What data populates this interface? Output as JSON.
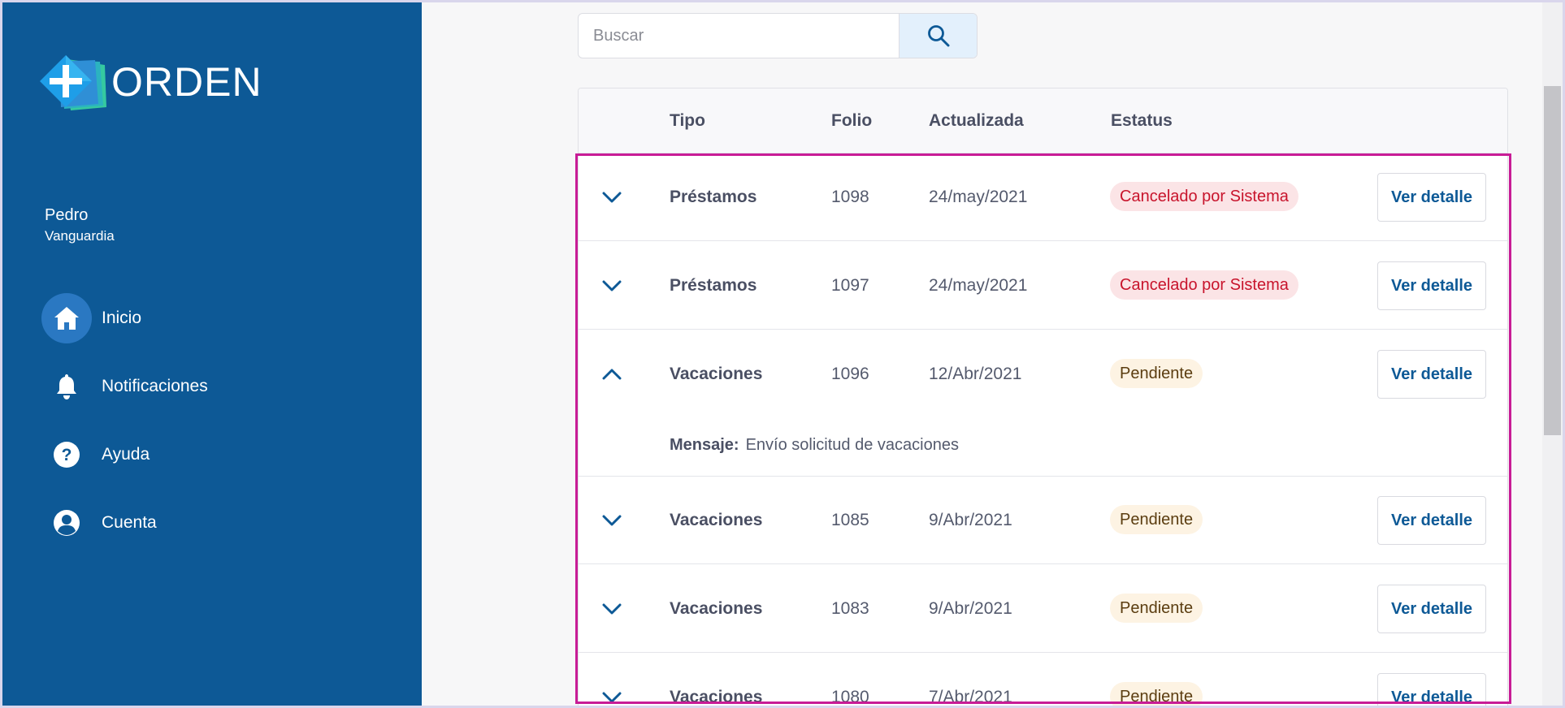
{
  "brand": {
    "name": "ORDEN"
  },
  "user": {
    "first_name": "Pedro",
    "last_name": "Vanguardia"
  },
  "nav": [
    {
      "label": "Inicio",
      "icon": "home-icon",
      "active": true
    },
    {
      "label": "Notificaciones",
      "icon": "bell-icon",
      "active": false
    },
    {
      "label": "Ayuda",
      "icon": "help-icon",
      "active": false
    },
    {
      "label": "Cuenta",
      "icon": "account-icon",
      "active": false
    }
  ],
  "search": {
    "placeholder": "Buscar",
    "value": ""
  },
  "table": {
    "headers": {
      "tipo": "Tipo",
      "folio": "Folio",
      "actualizada": "Actualizada",
      "estatus": "Estatus"
    },
    "rows": [
      {
        "tipo": "Préstamos",
        "folio": "1098",
        "actualizada": "24/may/2021",
        "estatus": "Cancelado por Sistema",
        "estatus_kind": "cancel",
        "action": "Ver detalle",
        "expanded": false
      },
      {
        "tipo": "Préstamos",
        "folio": "1097",
        "actualizada": "24/may/2021",
        "estatus": "Cancelado por Sistema",
        "estatus_kind": "cancel",
        "action": "Ver detalle",
        "expanded": false
      },
      {
        "tipo": "Vacaciones",
        "folio": "1096",
        "actualizada": "12/Abr/2021",
        "estatus": "Pendiente",
        "estatus_kind": "pending",
        "action": "Ver detalle",
        "expanded": true,
        "mensaje_label": "Mensaje:",
        "mensaje": "Envío solicitud de vacaciones"
      },
      {
        "tipo": "Vacaciones",
        "folio": "1085",
        "actualizada": "9/Abr/2021",
        "estatus": "Pendiente",
        "estatus_kind": "pending",
        "action": "Ver detalle",
        "expanded": false
      },
      {
        "tipo": "Vacaciones",
        "folio": "1083",
        "actualizada": "9/Abr/2021",
        "estatus": "Pendiente",
        "estatus_kind": "pending",
        "action": "Ver detalle",
        "expanded": false
      },
      {
        "tipo": "Vacaciones",
        "folio": "1080",
        "actualizada": "7/Abr/2021",
        "estatus": "Pendiente",
        "estatus_kind": "pending",
        "action": "Ver detalle",
        "expanded": false
      }
    ]
  },
  "colors": {
    "sidebar": "#0d5996",
    "active_nav": "#2a78c2",
    "cancel_text": "#c8142c",
    "cancel_bg": "#fbe4e6",
    "pending_bg": "#fdf3e3",
    "highlight": "#c81c96"
  }
}
